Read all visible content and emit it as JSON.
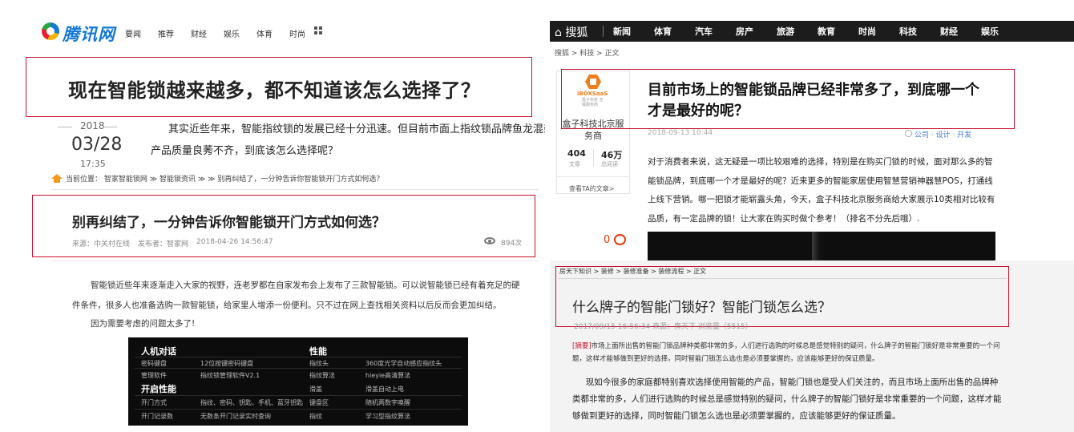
{
  "tencent": {
    "logo_text": "腾讯网",
    "nav": [
      "要闻",
      "推荐",
      "财经",
      "娱乐",
      "体育",
      "时尚"
    ],
    "headline": "现在智能锁越来越多，都不知道该怎么选择了？",
    "date_year": "2018",
    "date_md": "03/28",
    "date_time": "17:35",
    "lead_line1": "其实近些年来，智能指纹锁的发展已经十分迅速。但目前市面上指纹锁品牌鱼龙混杂，",
    "lead_line2": "产品质量良莠不齐，到底该怎么选择呢？"
  },
  "zhijia": {
    "breadcrumb": "当前位置： 智家智能锁网 ≫ 智能锁资讯 ≫ ≫ 别再纠结了，一分钟告诉你智能锁开门方式如何选？",
    "title": "别再纠结了，一分钟告诉你智能锁开门方式如何选？",
    "meta_source": "来源：中关村在线",
    "meta_author": "发布者：智家网",
    "meta_date": "2018-04-26 14:56:47",
    "views": "894次",
    "body_line1": "智能锁近些年来逐渐走入大家的视野，连老罗都在自家发布会上发布了三款智能锁。可以说智能锁已经有着充足的硬",
    "body_line2": "件条件，很多人也准备选购一款智能锁，给家里人增添一份便利。只不过在网上查找相关资料以后反而会更加纠结。",
    "body_line3": "因为需要考虑的问题太多了!",
    "table": {
      "h1": "人机对话",
      "h2": "性能",
      "h3": "开启性能",
      "r1": [
        "密码键盘",
        "12位按键密码键盘",
        "指纹头",
        "360度光学自动感应指纹头"
      ],
      "r2": [
        "管理软件",
        "指纹锁管理软件V2.1",
        "指纹算法",
        "hieyie高清算法"
      ],
      "r3": [
        "",
        "",
        "滑盖",
        "滑盖自动上电"
      ],
      "r4": [
        "开门方式",
        "指纹、密码、钥匙、手机、蓝牙钥匙",
        "键盘区",
        "随机两数字唤醒"
      ],
      "r5": [
        "开门记录数",
        "无数条开门记录实时查询",
        "指纹",
        "学习型指纹算法"
      ]
    }
  },
  "sohu": {
    "logo": "搜狐",
    "nav": [
      "新闻",
      "体育",
      "汽车",
      "房产",
      "旅游",
      "教育",
      "时尚",
      "科技",
      "财经",
      "娱乐"
    ],
    "breadcrumb": "搜狐 > 科技 > 正文",
    "brand_name": "iBOXSaaS",
    "brand_sub": "盒子科技 全域服务商",
    "author": "盒子科技北京服务商",
    "articles": "404",
    "articles_label": "文章",
    "reads": "46万",
    "reads_label": "总阅读",
    "view_more": "查看TA的文章>",
    "title": "目前市场上的智能锁品牌已经非常多了，到底哪一个才是最好的呢？",
    "date": "2018-09-13 10:44",
    "tags": "公司 · 设计 · 开发",
    "body": "对于消费者来说，这无疑是一项比较艰难的选择，特别是在购买门锁的时候，面对那么多的智能锁品牌，到底哪一个才是最好的呢？近来更多的智能家居使用智慧营销神器慧POS，打通线上线下营销。哪一把锁才能崭露头角，今天，盒子科技北京服务商给大家展示10类相对比较有品质，有一定品牌的锁！让大家在购买时做个参考！（排名不分先后哦）.",
    "comments": "0"
  },
  "fang": {
    "breadcrumb": "房天下知识 > 装修 > 装修准备 > 装修流程 > 正文",
    "title": "什么牌子的智能门锁好？智能门锁怎么选？",
    "meta": "2017/09/15 16:56:34  来源：房天下  浏览量（5515）",
    "abstract_tag": "[摘要]",
    "abstract": "市场上面所出售的智能门锁品牌种类都非常的多，人们进行选购的时候总是感觉特别的疑问，什么牌子的智能门锁好是非常重要的一个问题，这样才能够做到更好的选择，同时智能门锁怎么选也是必须要掌握的，应该能够更好的保证质量。",
    "body": "现如今很多的家庭都特别喜欢选择使用智能的产品，智能门锁也是受人们关注的，而且市场上面所出售的品牌种类都非常的多，人们进行选购的时候总是感觉特别的疑问，什么牌子的智能门锁好是非常重要的一个问题，这样才能够做到更好的选择，同时智能门锁怎么选也是必须要掌握的，应该能够更好的保证质量。"
  }
}
